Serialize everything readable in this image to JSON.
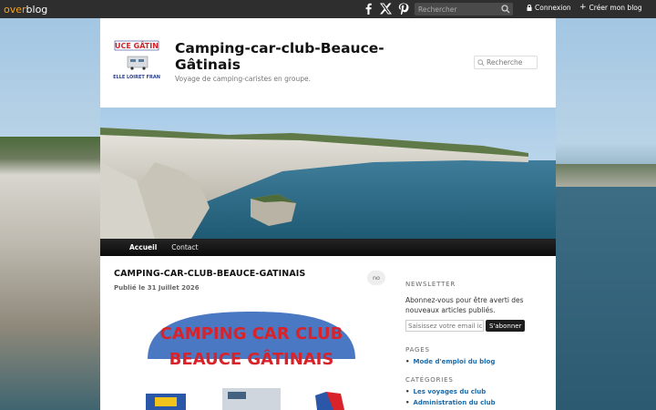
{
  "topbar": {
    "logo_over": "over",
    "logo_blog": "blog",
    "social": [
      "facebook-icon",
      "x-icon",
      "pinterest-icon"
    ],
    "search_placeholder": "Rechercher",
    "login_label": "Connexion",
    "create_label": "Créer mon blog"
  },
  "header": {
    "title": "Camping-car-club-Beauce-Gâtinais",
    "description": "Voyage de camping-caristes en groupe.",
    "search_placeholder": "Recherche",
    "logo_top_text": "UCE GÂTIN",
    "logo_bottom_text": "ELLE LOIRET FRAN"
  },
  "nav": {
    "items": [
      "Accueil",
      "Contact"
    ]
  },
  "post": {
    "title": "CAMPING-CAR-CLUB-BEAUCE-GATINAIS",
    "date": "Publié le 31 Juillet 2026",
    "comments": "no",
    "image_line1": "CAMPING CAR CLUB",
    "image_line2": "BEAUCE GÂTINAIS"
  },
  "sidebar": {
    "newsletter_title": "Newsletter",
    "newsletter_text": "Abonnez-vous pour être averti des nouveaux articles publiés.",
    "newsletter_placeholder": "Saisissez votre email ici",
    "newsletter_button": "S'abonner",
    "pages_title": "Pages",
    "pages": [
      "Mode d'emploi du blog"
    ],
    "categories_title": "Catégories",
    "categories": [
      "Les voyages du club",
      "Administration du club"
    ]
  },
  "colors": {
    "accent_orange": "#f7a21b",
    "link_blue": "#1b6aa9",
    "topbar_bg": "#2e2e2e"
  }
}
